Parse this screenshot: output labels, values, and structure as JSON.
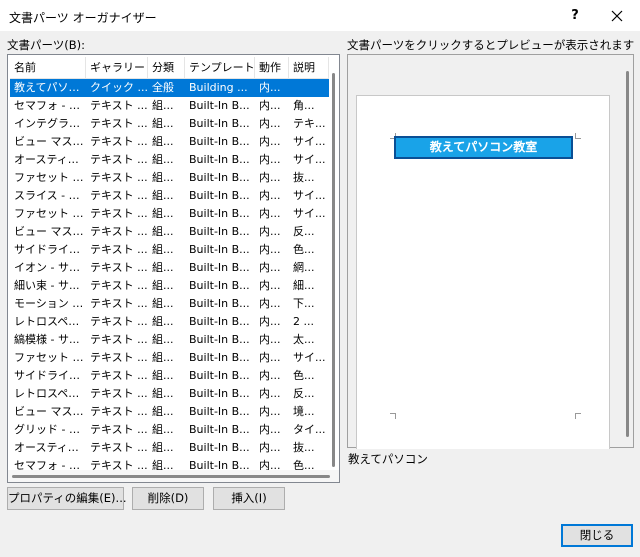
{
  "window": {
    "title": "文書パーツ オーガナイザー",
    "help_label": "?"
  },
  "list_label": "文書パーツ(B):",
  "preview_label": "文書パーツをクリックするとプレビューが表示されます",
  "columns": [
    "名前",
    "ギャラリー",
    "分類",
    "テンプレート",
    "動作",
    "説明"
  ],
  "rows": [
    {
      "name": "教えてパソコン",
      "gallery": "クイック ...",
      "category": "全般",
      "template": "Building ...",
      "behavior": "内...",
      "desc": "",
      "selected": true
    },
    {
      "name": "セマフォ - 引用",
      "gallery": "テキスト ...",
      "category": "組...",
      "template": "Built-In B...",
      "behavior": "内...",
      "desc": "角..."
    },
    {
      "name": "インテグラル - ...",
      "gallery": "テキスト ...",
      "category": "組...",
      "template": "Built-In B...",
      "behavior": "内...",
      "desc": "テキ..."
    },
    {
      "name": "ビュー マスター...",
      "gallery": "テキスト ...",
      "category": "組...",
      "template": "Built-In B...",
      "behavior": "内...",
      "desc": "サイ..."
    },
    {
      "name": "オースティン - ...",
      "gallery": "テキスト ...",
      "category": "組...",
      "template": "Built-In B...",
      "behavior": "内...",
      "desc": "サイ..."
    },
    {
      "name": "ファセット - ...",
      "gallery": "テキスト ...",
      "category": "組...",
      "template": "Built-In B...",
      "behavior": "内...",
      "desc": "抜..."
    },
    {
      "name": "スライス - サ...",
      "gallery": "テキスト ...",
      "category": "組...",
      "template": "Built-In B...",
      "behavior": "内...",
      "desc": "サイ..."
    },
    {
      "name": "ファセット - サ...",
      "gallery": "テキスト ...",
      "category": "組...",
      "template": "Built-In B...",
      "behavior": "内...",
      "desc": "サイ..."
    },
    {
      "name": "ビュー マスター...",
      "gallery": "テキスト ...",
      "category": "組...",
      "template": "Built-In B...",
      "behavior": "内...",
      "desc": "反..."
    },
    {
      "name": "サイドライン - ...",
      "gallery": "テキスト ...",
      "category": "組...",
      "template": "Built-In B...",
      "behavior": "内...",
      "desc": "色..."
    },
    {
      "name": "イオン - サイ...",
      "gallery": "テキスト ...",
      "category": "組...",
      "template": "Built-In B...",
      "behavior": "内...",
      "desc": "網..."
    },
    {
      "name": "細い束 - サ...",
      "gallery": "テキスト ...",
      "category": "組...",
      "template": "Built-In B...",
      "behavior": "内...",
      "desc": "細..."
    },
    {
      "name": "モーション - ...",
      "gallery": "テキスト ...",
      "category": "組...",
      "template": "Built-In B...",
      "behavior": "内...",
      "desc": "下..."
    },
    {
      "name": "レトロスペクト...",
      "gallery": "テキスト ...",
      "category": "組...",
      "template": "Built-In B...",
      "behavior": "内...",
      "desc": "2 ..."
    },
    {
      "name": "縞模様 - サ...",
      "gallery": "テキスト ...",
      "category": "組...",
      "template": "Built-In B...",
      "behavior": "内...",
      "desc": "太..."
    },
    {
      "name": "ファセット - サ...",
      "gallery": "テキスト ...",
      "category": "組...",
      "template": "Built-In B...",
      "behavior": "内...",
      "desc": "サイ..."
    },
    {
      "name": "サイドライン - ...",
      "gallery": "テキスト ...",
      "category": "組...",
      "template": "Built-In B...",
      "behavior": "内...",
      "desc": "色..."
    },
    {
      "name": "レトロスペクト...",
      "gallery": "テキスト ...",
      "category": "組...",
      "template": "Built-In B...",
      "behavior": "内...",
      "desc": "反..."
    },
    {
      "name": "ビュー マスター...",
      "gallery": "テキスト ...",
      "category": "組...",
      "template": "Built-In B...",
      "behavior": "内...",
      "desc": "境..."
    },
    {
      "name": "グリッド - サイ...",
      "gallery": "テキスト ...",
      "category": "組...",
      "template": "Built-In B...",
      "behavior": "内...",
      "desc": "タイ..."
    },
    {
      "name": "オースティン - ...",
      "gallery": "テキスト ...",
      "category": "組...",
      "template": "Built-In B...",
      "behavior": "内...",
      "desc": "抜..."
    },
    {
      "name": "セマフォ - サ...",
      "gallery": "テキスト ...",
      "category": "組...",
      "template": "Built-In B...",
      "behavior": "内...",
      "desc": "色..."
    }
  ],
  "preview": {
    "banner_text": "教えてパソコン教室",
    "banner_color": "#19a3e8",
    "item_name": "教えてパソコン"
  },
  "buttons": {
    "properties": "プロパティの編集(E)...",
    "delete": "削除(D)",
    "insert": "挿入(I)",
    "close": "閉じる"
  },
  "colors": {
    "selection": "#0078d7",
    "default_button_border": "#0078d7"
  }
}
